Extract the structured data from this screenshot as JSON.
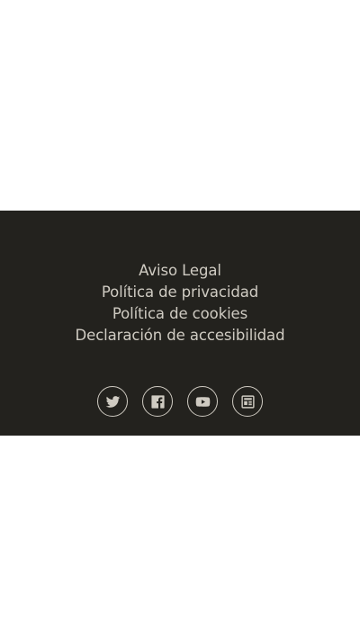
{
  "footer": {
    "background": "#23221e",
    "text_color": "#cfcbc2",
    "links": [
      {
        "label": "Aviso Legal"
      },
      {
        "label": "Política de privacidad"
      },
      {
        "label": "Política de cookies"
      },
      {
        "label": "Declaración de accesibilidad"
      }
    ],
    "social": [
      {
        "icon": "twitter-icon"
      },
      {
        "icon": "facebook-icon"
      },
      {
        "icon": "youtube-icon"
      },
      {
        "icon": "newspaper-icon"
      }
    ]
  }
}
